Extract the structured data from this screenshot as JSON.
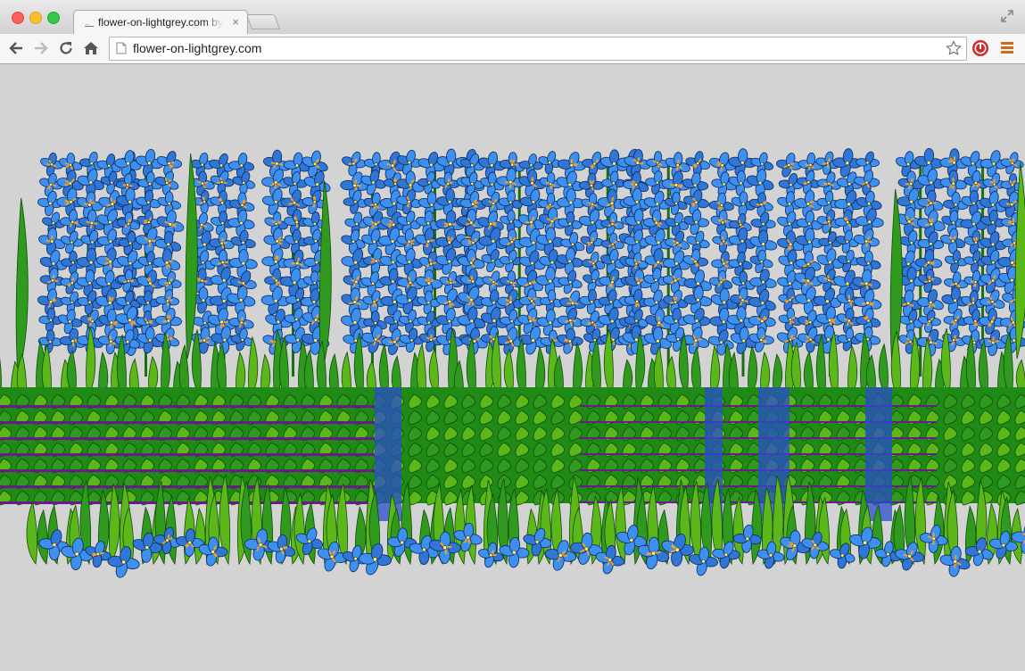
{
  "tab": {
    "title": "flower-on-lightgrey.com by",
    "close_glyph": "×"
  },
  "omnibox": {
    "url": "flower-on-lightgrey.com"
  },
  "icons": {
    "back": "arrow-left-icon",
    "forward": "arrow-right-icon",
    "reload": "reload-icon",
    "home": "home-icon",
    "page": "page-icon",
    "star": "star-icon",
    "extension": "stop-extension-icon",
    "menu": "hamburger-menu-icon",
    "fullscreen": "fullscreen-icon"
  },
  "colors": {
    "page_background": "#d3d3d3",
    "flower_blue": "#3d8ff0",
    "leaf_green": "#2f9a1e",
    "stamen_orange": "#f0a030",
    "stripe_purple": "#6a1a8a"
  }
}
